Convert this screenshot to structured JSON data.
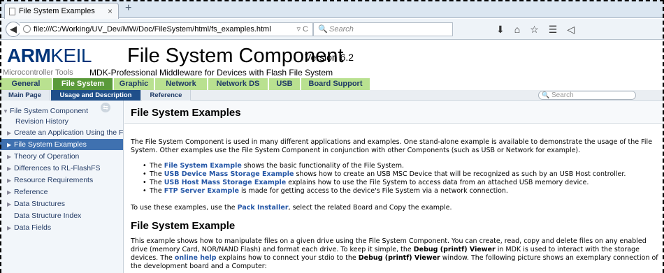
{
  "browser": {
    "tab_title": "File System Examples",
    "tab_close": "×",
    "new_tab": "+",
    "url": "file:///C:/Working/UV_Dev/MW/Doc/FileSystem/html/fs_examples.html",
    "url_controls": "▿ C",
    "search_placeholder": "Search",
    "nav_icons": [
      "download-icon",
      "home-icon",
      "bookmark-star-icon",
      "reading-list-icon",
      "send-icon"
    ]
  },
  "banner": {
    "logo_arm": "ARM",
    "logo_keil": "KEIL",
    "mctools": "Microcontroller Tools",
    "title": "File System Component",
    "version": "Version 6.2",
    "subtitle": "MDK-Professional Middleware for Devices with Flash File System"
  },
  "main_tabs": [
    "General",
    "File System",
    "Graphic",
    "Network",
    "Network DS",
    "USB",
    "Board Support"
  ],
  "sub_tabs": [
    "Main Page",
    "Usage and Description",
    "Reference"
  ],
  "doc_search_placeholder": "Search",
  "sidebar": {
    "items": [
      {
        "label": "File System Component",
        "arrow": "▼"
      },
      {
        "label": "Revision History",
        "arrow": ""
      },
      {
        "label": "Create an Application Using the File",
        "arrow": "▶"
      },
      {
        "label": "File System Examples",
        "arrow": "▶"
      },
      {
        "label": "Theory of Operation",
        "arrow": "▶"
      },
      {
        "label": "Differences to RL-FlashFS",
        "arrow": "▶"
      },
      {
        "label": "Resource Requirements",
        "arrow": "▶"
      },
      {
        "label": "Reference",
        "arrow": "▶"
      },
      {
        "label": "Data Structures",
        "arrow": "▶"
      },
      {
        "label": "Data Structure Index",
        "arrow": ""
      },
      {
        "label": "Data Fields",
        "arrow": "▶"
      }
    ]
  },
  "content": {
    "heading": "File System Examples",
    "intro": "The File System Component is used in many different applications and examples. One stand-alone example is available to demonstrate the usage of the File System. Other examples use the File System Component in conjunction with other Components (such as USB or Network for example).",
    "bullet_lead": "The",
    "bullets": [
      {
        "link": "File System Example",
        "text": "shows the basic functionality of the File System."
      },
      {
        "link": "USB Device Mass Storage Example",
        "text": "shows how to create an USB MSC Device that will be recognized as such by an USB Host controller."
      },
      {
        "link": "USB Host Mass Storage Example",
        "text": "explains how to use the File System to access data from an attached USB memory device."
      },
      {
        "link": "FTP Server Example",
        "text": "is made for getting access to the device's File System via a network connection."
      }
    ],
    "pack_pre": "To use these examples, use the",
    "pack_link": "Pack Installer",
    "pack_post": ", select the related Board and Copy the example.",
    "section2": "File System Example",
    "p2_a": "This example shows how to manipulate files on a given drive using the File System Component. You can create, read, copy and delete files on any enabled drive (memory Card, NOR/NAND Flash) and format each drive. To keep it simple, the",
    "p2_b": "Debug (printf) Viewer",
    "p2_c": "in MDK is used to interact with the storage devices. The",
    "p2_d": "online help",
    "p2_e": "explains how to connect your stdio to the",
    "p2_f": "Debug (printf) Viewer",
    "p2_g": "window. The following picture shows an exemplary connection of the development board and a Computer:"
  }
}
